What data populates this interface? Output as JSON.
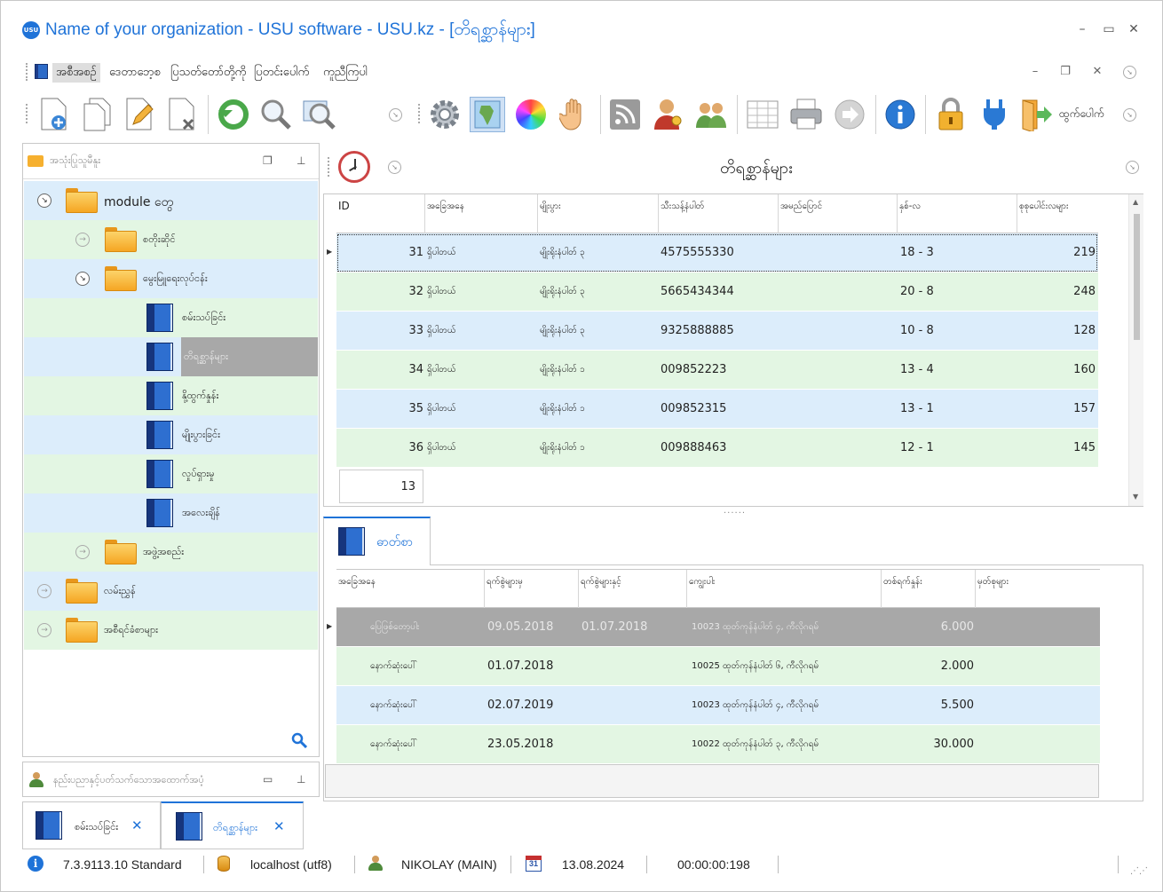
{
  "window": {
    "logo_text": "USU",
    "title": "Name of your organization - USU software - USU.kz - [တိရစ္ဆာန်များ]"
  },
  "menu": {
    "items": [
      {
        "label": "အစီအစဉ်",
        "active": true
      },
      {
        "label": "ဒေတာဘေ့စ"
      },
      {
        "label": "ပြသတ်တော်တို့ကို"
      },
      {
        "label": "ပြတင်းပေါက်"
      },
      {
        "label": "ကူညီကြပါ"
      }
    ]
  },
  "toolbar": {
    "exit_label": "ထွက်ပေါက်"
  },
  "left_panel": {
    "title": "အသုံးပြုသူမီနူး",
    "tree": [
      {
        "label": "module တွေ"
      },
      {
        "label": "စတိုးဆိုင်"
      },
      {
        "label": "မွေးမြူရေးလုပ်ငန်း"
      },
      {
        "label": "စမ်းသပ်ခြင်း"
      },
      {
        "label": "တိရစ္ဆာန်များ"
      },
      {
        "label": "နို့ထွက်နှုန်း"
      },
      {
        "label": "မျိုးပွားခြင်း"
      },
      {
        "label": "လှုပ်ရှားမှု"
      },
      {
        "label": "အလေးချိန်"
      },
      {
        "label": "အဖွဲ့အစည်း"
      },
      {
        "label": "လမ်းညွှန်"
      },
      {
        "label": "အစီရင်ခံစာများ"
      }
    ],
    "bottom_label": "နည်းပညာနှင့်ပတ်သက်သောအထောက်အပံ့"
  },
  "main": {
    "title": "တိရစ္ဆာန်များ",
    "columns": [
      "ID",
      "အခြေအနေ",
      "မျိုးပွား",
      "သီးသန့်နံပါတ်",
      "အမည်ပြောင်",
      "နှစ်-လ",
      "စုစုပေါင်းလများ"
    ],
    "rows": [
      {
        "id": "31",
        "status": "ရှိပါတယ်",
        "breed": "မျိုးရိုးနံပါတ် ၃",
        "number": "4575555330",
        "nickname": "",
        "age": "18 - 3",
        "total": "219"
      },
      {
        "id": "32",
        "status": "ရှိပါတယ်",
        "breed": "မျိုးရိုးနံပါတ် ၃",
        "number": "5665434344",
        "nickname": "",
        "age": "20 - 8",
        "total": "248"
      },
      {
        "id": "33",
        "status": "ရှိပါတယ်",
        "breed": "မျိုးရိုးနံပါတ် ၃",
        "number": "9325888885",
        "nickname": "",
        "age": "10 - 8",
        "total": "128"
      },
      {
        "id": "34",
        "status": "ရှိပါတယ်",
        "breed": "မျိုးရိုးနံပါတ် ၁",
        "number": "009852223",
        "nickname": "",
        "age": "13 - 4",
        "total": "160"
      },
      {
        "id": "35",
        "status": "ရှိပါတယ်",
        "breed": "မျိုးရိုးနံပါတ် ၁",
        "number": "009852315",
        "nickname": "",
        "age": "13 - 1",
        "total": "157"
      },
      {
        "id": "36",
        "status": "ရှိပါတယ်",
        "breed": "မျိုးရိုးနံပါတ် ၁",
        "number": "009888463",
        "nickname": "",
        "age": "12 - 1",
        "total": "145"
      }
    ],
    "count": "13"
  },
  "detail": {
    "tab_label": "ဓာတ်စာ",
    "columns": [
      "အခြေအနေ",
      "ရက်စွဲများမှ",
      "ရက်စွဲများနှင့်",
      "ကျွေးပါး",
      "တစ်ရက်နှုန်း",
      "မှတ်စုများ"
    ],
    "rows": [
      {
        "status": "ပြေဖြစ်တော့ပါး",
        "from": "09.05.2018",
        "to": "01.07.2018",
        "feed": "10023 ထုတ်ကုန်နံပါတ် ၄, ကီလိုဂရမ်",
        "rate": "6.000",
        "notes": ""
      },
      {
        "status": "နောက်ဆုံးပေါ်",
        "from": "01.07.2018",
        "to": "",
        "feed": "10025 ထုတ်ကုန်နံပါတ် ၆, ကီလိုဂရမ်",
        "rate": "2.000",
        "notes": ""
      },
      {
        "status": "နောက်ဆုံးပေါ်",
        "from": "02.07.2019",
        "to": "",
        "feed": "10023 ထုတ်ကုန်နံပါတ် ၄, ကီလိုဂရမ်",
        "rate": "5.500",
        "notes": ""
      },
      {
        "status": "နောက်ဆုံးပေါ်",
        "from": "23.05.2018",
        "to": "",
        "feed": "10022 ထုတ်ကုန်နံပါတ် ၃, ကီလိုဂရမ်",
        "rate": "30.000",
        "notes": ""
      }
    ]
  },
  "doc_tabs": [
    {
      "label": "စမ်းသပ်ခြင်း"
    },
    {
      "label": "တိရစ္ဆာန်များ",
      "active": true
    }
  ],
  "status": {
    "version": "7.3.9113.10 Standard",
    "db": "localhost (utf8)",
    "user": "NIKOLAY (MAIN)",
    "calendar_day": "31",
    "date": "13.08.2024",
    "timer": "00:00:00:198"
  },
  "colors": {
    "accent": "#1f73d8",
    "row_blue": "#dcedfb",
    "row_green": "#e3f6e3",
    "selected": "#a8a8a8"
  }
}
